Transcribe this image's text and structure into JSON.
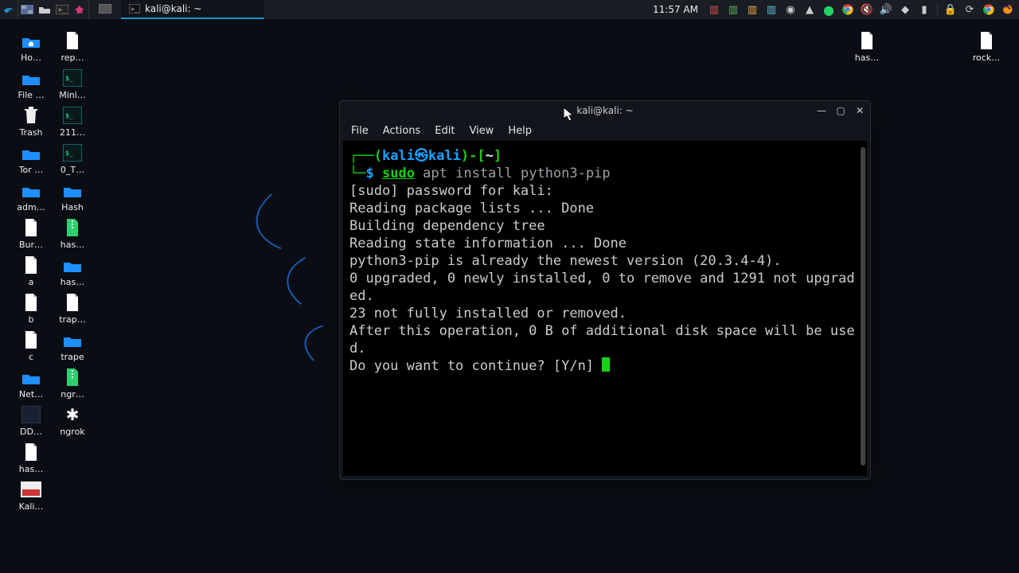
{
  "panel": {
    "task_title": "kali@kali: ~",
    "clock": "11:57 AM",
    "launchers": [
      "kali-menu",
      "workspace",
      "files",
      "terminal",
      "flameshot"
    ],
    "tray": [
      "doc-lo",
      "doc-cl",
      "doc-pr",
      "doc-wr",
      "camera",
      "wifi",
      "chrome-chat",
      "chrome",
      "speaker-off",
      "speaker",
      "bell",
      "battery",
      "lock",
      "power",
      "firefox-color",
      "firefox-dark"
    ]
  },
  "desktop": {
    "left_col1": [
      {
        "label": "Ho…",
        "type": "folder-home"
      },
      {
        "label": "File …",
        "type": "folder"
      },
      {
        "label": "Trash",
        "type": "trash"
      },
      {
        "label": "Tor …",
        "type": "folder"
      },
      {
        "label": "adm…",
        "type": "folder"
      },
      {
        "label": "Bur…",
        "type": "file"
      },
      {
        "label": "a",
        "type": "file"
      },
      {
        "label": "b",
        "type": "file"
      },
      {
        "label": "c",
        "type": "file"
      },
      {
        "label": "Net…",
        "type": "folder"
      },
      {
        "label": "DD…",
        "type": "app"
      },
      {
        "label": "has…",
        "type": "file"
      },
      {
        "label": "Kali…",
        "type": "thumb"
      }
    ],
    "left_col2": [
      {
        "label": "rep…",
        "type": "file"
      },
      {
        "label": "Mini…",
        "type": "app-dark"
      },
      {
        "label": "211…",
        "type": "app-dark"
      },
      {
        "label": "0_T…",
        "type": "app-dark"
      },
      {
        "label": "Hash",
        "type": "folder"
      },
      {
        "label": "has…",
        "type": "zip"
      },
      {
        "label": "has…",
        "type": "folder"
      },
      {
        "label": "trap…",
        "type": "file"
      },
      {
        "label": "trape",
        "type": "folder"
      },
      {
        "label": "ngr…",
        "type": "zip"
      },
      {
        "label": "ngrok",
        "type": "gear"
      }
    ],
    "right": [
      {
        "label": "has…",
        "type": "file"
      },
      {
        "label": "rock…",
        "type": "file"
      }
    ]
  },
  "terminal": {
    "title": "kali@kali: ~",
    "menus": [
      "File",
      "Actions",
      "Edit",
      "View",
      "Help"
    ],
    "prompt_user": "kali㉿kali",
    "prompt_path": "~",
    "prompt_symbol": "$",
    "cmd_sudo": "sudo",
    "cmd_rest": " apt install python3-pip",
    "lines": [
      "[sudo] password for kali:",
      "Reading package lists ... Done",
      "Building dependency tree",
      "Reading state information ... Done",
      "python3-pip is already the newest version (20.3.4-4).",
      "0 upgraded, 0 newly installed, 0 to remove and 1291 not upgraded.",
      "23 not fully installed or removed.",
      "After this operation, 0 B of additional disk space will be used.",
      "Do you want to continue? [Y/n] "
    ]
  },
  "window_controls": {
    "min": "—",
    "max": "▢",
    "close": "✕"
  }
}
